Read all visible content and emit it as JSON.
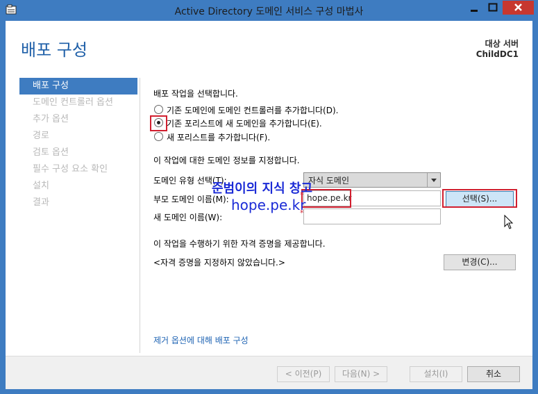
{
  "window": {
    "title": "Active Directory 도메인 서비스 구성 마법사"
  },
  "header": {
    "page_title": "배포 구성",
    "target_label": "대상 서버",
    "target_name": "ChildDC1"
  },
  "sidebar": {
    "items": [
      {
        "label": "배포 구성",
        "active": true
      },
      {
        "label": "도메인 컨트롤러 옵션"
      },
      {
        "label": "추가 옵션"
      },
      {
        "label": "경로"
      },
      {
        "label": "검토 옵션"
      },
      {
        "label": "필수 구성 요소 확인"
      },
      {
        "label": "설치"
      },
      {
        "label": "결과"
      }
    ]
  },
  "main": {
    "select_operation": "배포 작업을 선택합니다.",
    "options": [
      {
        "label": "기존 도메인에 도메인 컨트롤러를 추가합니다(D).",
        "checked": false
      },
      {
        "label": "기존 포리스트에 새 도메인을 추가합니다(E).",
        "checked": true
      },
      {
        "label": "새 포리스트를 추가합니다(F).",
        "checked": false
      }
    ],
    "domain_info_heading": "이 작업에 대한 도메인 정보를 지정합니다.",
    "domain_type_label": "도메인 유형 선택(T):",
    "domain_type_value": "자식 도메인",
    "parent_domain_label": "부모 도메인 이름(M):",
    "parent_domain_value": "hope.pe.kr",
    "select_button": "선택(S)...",
    "new_domain_label": "새 도메인 이름(W):",
    "new_domain_value": "",
    "credentials_heading": "이 작업을 수행하기 위한 자격 증명을 제공합니다.",
    "credentials_value": "<자격 증명을 지정하지 않았습니다.>",
    "change_button": "변경(C)...",
    "more_link": "제거 옵션에 대해 배포 구성",
    "watermark_line1": "준범이의 지식 창고",
    "watermark_line2": "hope.pe.kr"
  },
  "footer": {
    "prev_button": "< 이전(P)",
    "next_button": "다음(N) >",
    "install_button": "설치(I)",
    "cancel_button": "취소"
  },
  "colors": {
    "accent": "#3e7cc1",
    "highlight_red": "#d11f2f",
    "watermark_blue": "#1a2ad6"
  }
}
